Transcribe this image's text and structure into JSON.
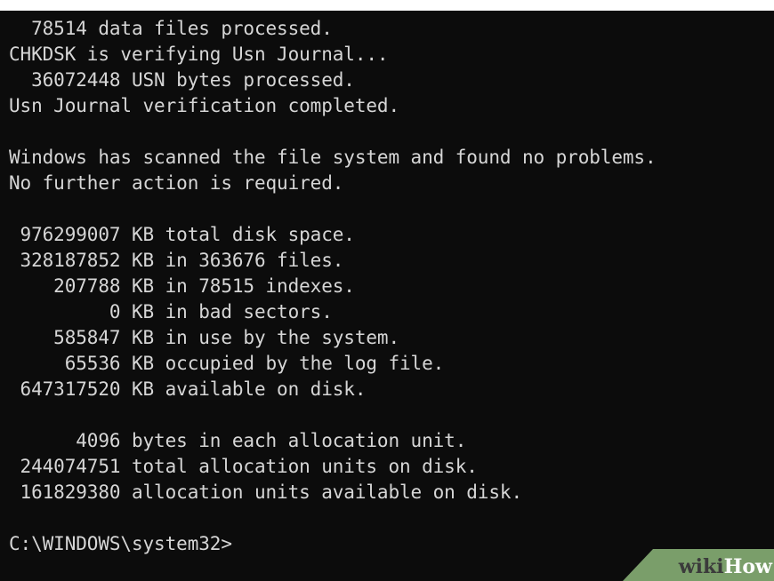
{
  "console": {
    "lines": [
      "  78514 data files processed.",
      "CHKDSK is verifying Usn Journal...",
      "  36072448 USN bytes processed.",
      "Usn Journal verification completed.",
      "",
      "Windows has scanned the file system and found no problems.",
      "No further action is required.",
      "",
      " 976299007 KB total disk space.",
      " 328187852 KB in 363676 files.",
      "    207788 KB in 78515 indexes.",
      "         0 KB in bad sectors.",
      "    585847 KB in use by the system.",
      "     65536 KB occupied by the log file.",
      " 647317520 KB available on disk.",
      "",
      "      4096 bytes in each allocation unit.",
      " 244074751 total allocation units on disk.",
      " 161829380 allocation units available on disk.",
      "",
      "C:\\WINDOWS\\system32>"
    ],
    "prompt": "C:\\WINDOWS\\system32>"
  },
  "watermark": {
    "brand": "wikiHow"
  },
  "colors": {
    "background": "#0c0c0c",
    "text": "#d6d6d6",
    "watermark_bg": "#7a9e6a"
  }
}
